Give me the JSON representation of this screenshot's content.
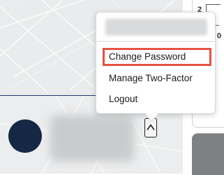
{
  "user_menu": {
    "items": [
      {
        "label": "Change Password",
        "highlighted": true
      },
      {
        "label": "Manage Two-Factor"
      },
      {
        "label": "Logout"
      }
    ]
  },
  "right_panel": {
    "top_value": "2",
    "second_value": "0"
  },
  "colors": {
    "highlight_border": "#e5523d",
    "avatar": "#142845",
    "divider_line": "#1f3a68"
  },
  "icons": {
    "toggle": "chevron-up-icon"
  }
}
